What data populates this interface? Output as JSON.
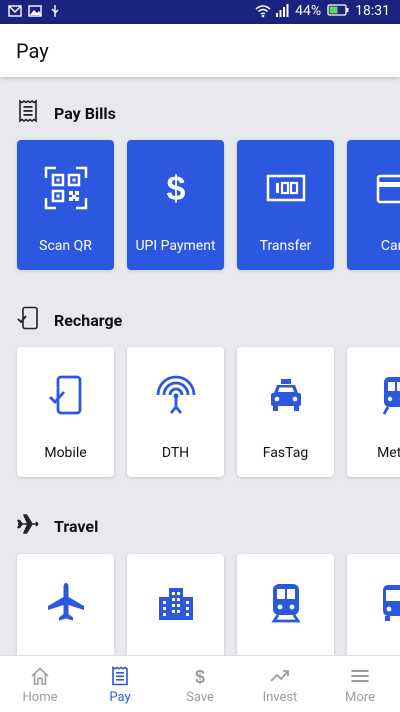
{
  "status_bar": {
    "battery": "44%",
    "time": "18:31"
  },
  "app_bar": {
    "title": "Pay"
  },
  "sections": [
    {
      "title": "Pay Bills",
      "icon": "receipt-icon",
      "items": [
        {
          "label": "Scan QR",
          "icon": "qr-code-icon"
        },
        {
          "label": "UPI Payment",
          "icon": "dollar-icon"
        },
        {
          "label": "Transfer",
          "icon": "cash-icon"
        },
        {
          "label": "Card",
          "icon": "credit-card-icon"
        }
      ]
    },
    {
      "title": "Recharge",
      "icon": "phone-check-icon",
      "items": [
        {
          "label": "Mobile",
          "icon": "phone-check-icon"
        },
        {
          "label": "DTH",
          "icon": "satellite-icon"
        },
        {
          "label": "FasTag",
          "icon": "taxi-icon"
        },
        {
          "label": "Metro",
          "icon": "train-icon"
        }
      ]
    },
    {
      "title": "Travel",
      "icon": "airplane-icon",
      "items": [
        {
          "label": "",
          "icon": "airplane-icon"
        },
        {
          "label": "",
          "icon": "building-icon"
        },
        {
          "label": "",
          "icon": "train-icon"
        },
        {
          "label": "",
          "icon": "bus-icon"
        }
      ]
    }
  ],
  "bottom_nav": {
    "items": [
      {
        "label": "Home",
        "icon": "home-icon"
      },
      {
        "label": "Pay",
        "icon": "receipt-icon"
      },
      {
        "label": "Save",
        "icon": "dollar-icon"
      },
      {
        "label": "Invest",
        "icon": "trending-up-icon"
      },
      {
        "label": "More",
        "icon": "menu-icon"
      }
    ],
    "active_index": 1
  },
  "colors": {
    "primary": "#2b58de",
    "status_bar": "#1a237e",
    "background": "#e8e9ed"
  }
}
